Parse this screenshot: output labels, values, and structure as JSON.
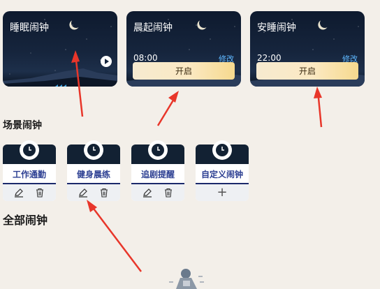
{
  "top_cards": [
    {
      "title": "睡眠闹钟"
    },
    {
      "title": "晨起闹钟",
      "time": "08:00",
      "edit_label": "修改",
      "button_label": "开启"
    },
    {
      "title": "安睡闹钟",
      "time": "22:00",
      "edit_label": "修改",
      "button_label": "开启"
    }
  ],
  "scene_section": {
    "title": "场景闹钟"
  },
  "scene_cards": [
    {
      "name": "工作通勤",
      "actions": [
        "edit-icon",
        "trash-icon"
      ]
    },
    {
      "name": "健身晨练",
      "actions": [
        "edit-icon",
        "trash-icon"
      ]
    },
    {
      "name": "追剧提醒",
      "actions": [
        "edit-icon",
        "trash-icon"
      ]
    },
    {
      "name": "自定义闹钟",
      "actions": [
        "plus-icon"
      ],
      "add_label": "+"
    }
  ],
  "all_section": {
    "title": "全部闹钟"
  },
  "colors": {
    "background": "#f3efe9",
    "card_night": "#16253d",
    "edit_link": "#5fb8ff",
    "scene_name": "#2c3f92",
    "arrow": "#e8362a"
  }
}
